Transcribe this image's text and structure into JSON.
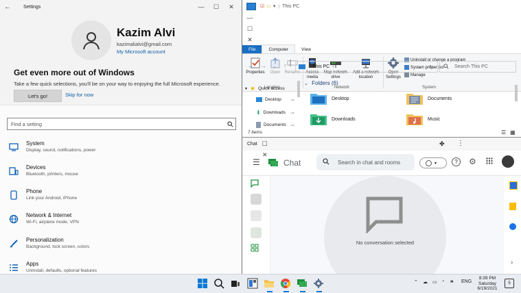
{
  "settings": {
    "window_title": "Settings",
    "profile": {
      "name": "Kazim Alvi",
      "email": "kazimalialvi@gmail.com",
      "account_link": "My Microsoft account"
    },
    "promo": {
      "heading": "Get even more out of Windows",
      "body": "Take a few quick selections, you'll be on your way to enjoying the full Microsoft experience.",
      "primary_button": "Let's go!",
      "secondary_link": "Skip for now"
    },
    "search": {
      "placeholder": "Find a setting"
    },
    "categories": [
      {
        "name": "System",
        "desc": "Display, sound, notifications, power",
        "icon": "monitor-icon"
      },
      {
        "name": "Devices",
        "desc": "Bluetooth, printers, mouse",
        "icon": "devices-icon"
      },
      {
        "name": "Phone",
        "desc": "Link your Android, iPhone",
        "icon": "phone-icon"
      },
      {
        "name": "Network & Internet",
        "desc": "Wi-Fi, airplane mode, VPN",
        "icon": "globe-icon"
      },
      {
        "name": "Personalization",
        "desc": "Background, lock screen, colors",
        "icon": "brush-icon"
      },
      {
        "name": "Apps",
        "desc": "Uninstall, defaults, optional features",
        "icon": "apps-icon"
      }
    ]
  },
  "explorer": {
    "window_title": "This PC",
    "tabs": [
      "File",
      "Computer",
      "View"
    ],
    "ribbon": {
      "location": {
        "group": "Location",
        "buttons": [
          "Properties",
          "Open",
          "Rename"
        ]
      },
      "network": {
        "group": "Network",
        "buttons": [
          "Access media",
          "Map network drive",
          "Add a network location"
        ]
      },
      "system": {
        "group": "System",
        "open_settings": "Open Settings",
        "items": [
          "Uninstall or change a program",
          "System properties",
          "Manage"
        ]
      }
    },
    "address": "This PC",
    "search_placeholder": "Search This PC",
    "nav": {
      "quick_access": "Quick access",
      "items": [
        "Desktop",
        "Downloads",
        "Documents"
      ]
    },
    "folders_header": "Folders (6)",
    "folders": [
      "Desktop",
      "Documents",
      "Downloads",
      "Music"
    ],
    "status": "7 items"
  },
  "chat": {
    "window_title": "Chat",
    "app_name": "Chat",
    "search_placeholder": "Search in chat and rooms",
    "empty_message": "No conversation selected"
  },
  "taskbar": {
    "tray": {
      "lang": "ENG",
      "time": "8:39 PM",
      "day": "Saturday",
      "date": "6/19/2021",
      "notifications": "5"
    }
  },
  "colors": {
    "accent": "#0b5fb5",
    "chat_green": "#1e8e3e",
    "file_tab": "#1a6fc3"
  }
}
